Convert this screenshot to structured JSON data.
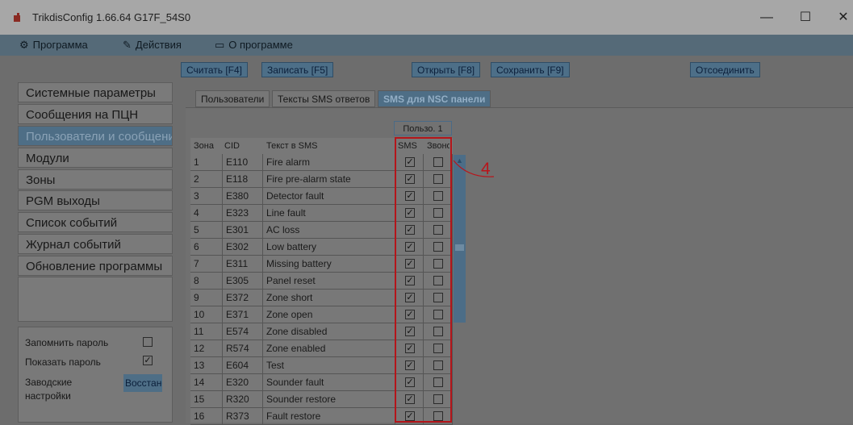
{
  "window": {
    "title": "TrikdisConfig 1.66.64   G17F_54S0",
    "minimize_glyph": "—",
    "maximize_glyph": "☐",
    "close_glyph": "✕"
  },
  "menu": [
    {
      "icon": "gear-icon",
      "glyph": "⚙",
      "label": "Программа"
    },
    {
      "icon": "wrench-icon",
      "glyph": "✎",
      "label": "Действия"
    },
    {
      "icon": "keyboard-icon",
      "glyph": "▭",
      "label": "О программе"
    }
  ],
  "toolbar": {
    "read": "Считать [F4]",
    "write": "Записать [F5]",
    "open": "Открыть [F8]",
    "save": "Сохранить [F9]",
    "disconnect": "Отсоединить"
  },
  "nav": [
    {
      "label": "Системные параметры",
      "active": false
    },
    {
      "label": "Сообщения на ПЦН",
      "active": false
    },
    {
      "label": "Пользователи и сообщения",
      "active": true
    },
    {
      "label": "Модули",
      "active": false
    },
    {
      "label": "Зоны",
      "active": false
    },
    {
      "label": "PGM выходы",
      "active": false
    },
    {
      "label": "Список событий",
      "active": false
    },
    {
      "label": "Журнал событий",
      "active": false
    },
    {
      "label": "Обновление программы",
      "active": false
    }
  ],
  "options": {
    "remember_password": {
      "label": "Запомнить пароль",
      "checked": false
    },
    "show_password": {
      "label": "Показать пароль",
      "checked": true
    },
    "factory_label_1": "Заводские",
    "factory_label_2": "настройки",
    "restore_button": "Восстановить"
  },
  "tabs": [
    {
      "label": "Пользователи",
      "active": false
    },
    {
      "label": "Тексты SMS ответов",
      "active": false
    },
    {
      "label": "SMS для NSC панели",
      "active": true
    }
  ],
  "table": {
    "user_group": "Пользо. 1",
    "columns": {
      "zone": "Зона",
      "cid": "CID",
      "text": "Текст в SMS",
      "sms": "SMS",
      "call": "Звонок"
    },
    "rows": [
      {
        "zone": "1",
        "cid": "E110",
        "text": "Fire alarm",
        "sms": true,
        "call": false
      },
      {
        "zone": "2",
        "cid": "E118",
        "text": "Fire pre-alarm state",
        "sms": true,
        "call": false
      },
      {
        "zone": "3",
        "cid": "E380",
        "text": "Detector fault",
        "sms": true,
        "call": false
      },
      {
        "zone": "4",
        "cid": "E323",
        "text": "Line fault",
        "sms": true,
        "call": false
      },
      {
        "zone": "5",
        "cid": "E301",
        "text": "AC loss",
        "sms": true,
        "call": false
      },
      {
        "zone": "6",
        "cid": "E302",
        "text": "Low battery",
        "sms": true,
        "call": false
      },
      {
        "zone": "7",
        "cid": "E311",
        "text": "Missing battery",
        "sms": true,
        "call": false
      },
      {
        "zone": "8",
        "cid": "E305",
        "text": "Panel reset",
        "sms": true,
        "call": false
      },
      {
        "zone": "9",
        "cid": "E372",
        "text": "Zone short",
        "sms": true,
        "call": false
      },
      {
        "zone": "10",
        "cid": "E371",
        "text": "Zone open",
        "sms": true,
        "call": false
      },
      {
        "zone": "11",
        "cid": "E574",
        "text": "Zone disabled",
        "sms": true,
        "call": false
      },
      {
        "zone": "12",
        "cid": "R574",
        "text": "Zone enabled",
        "sms": true,
        "call": false
      },
      {
        "zone": "13",
        "cid": "E604",
        "text": "Test",
        "sms": true,
        "call": false
      },
      {
        "zone": "14",
        "cid": "E320",
        "text": "Sounder fault",
        "sms": true,
        "call": false
      },
      {
        "zone": "15",
        "cid": "R320",
        "text": "Sounder restore",
        "sms": true,
        "call": false
      },
      {
        "zone": "16",
        "cid": "R373",
        "text": "Fault restore",
        "sms": true,
        "call": false
      }
    ]
  },
  "callout": {
    "number": "4",
    "color": "#b8151b"
  },
  "colors": {
    "accent": "#4e6e86",
    "highlight": "#b4151a"
  }
}
